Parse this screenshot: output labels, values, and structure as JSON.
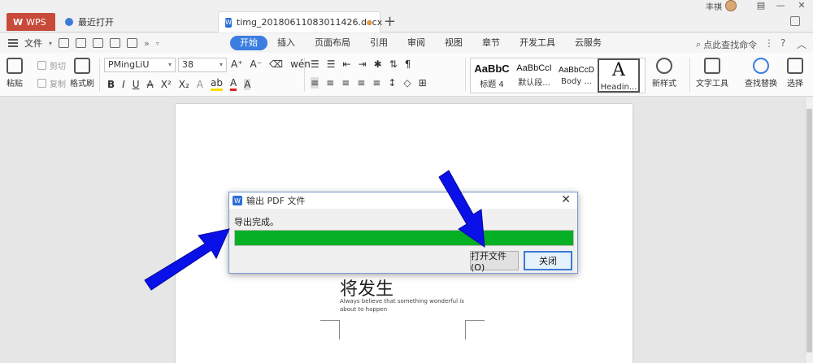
{
  "titlebar": {
    "wps_tab": "WPS",
    "recent_tab": "最近打开",
    "doc_tab": "timg_20180611083011426.docx",
    "add_tab": "+",
    "user_name": "丰祺"
  },
  "menubar": {
    "file_label": "文件",
    "ribbon_tabs": [
      "开始",
      "插入",
      "页面布局",
      "引用",
      "审阅",
      "视图",
      "章节",
      "开发工具",
      "云服务"
    ],
    "search_cmd": "点此查找命令"
  },
  "ribbon": {
    "paste": "粘贴",
    "cut": "剪切",
    "copy": "复制",
    "format_painter": "格式刷",
    "font_name": "PMingLiU",
    "font_size": "38",
    "styles": [
      {
        "preview": "AaBbC",
        "label": "标题 4"
      },
      {
        "preview": "AaBbCcI",
        "label": "默认段..."
      },
      {
        "preview": "AaBbCcD",
        "label": "Body ..."
      },
      {
        "preview": "A",
        "label": "Headin..."
      }
    ],
    "new_style": "新样式",
    "text_tools": "文字工具",
    "find_replace": "查找替换",
    "select": "选择"
  },
  "document": {
    "heading": "将发生",
    "subtext": "Always believe that something wonderful is about to happen"
  },
  "dialog": {
    "title": "输出 PDF 文件",
    "message": "导出完成。",
    "progress": 1.0,
    "open_button": "打开文件(O)",
    "close_button": "关闭",
    "progress_color": "#06b025"
  },
  "annotations": {
    "arrow_color": "#0a10e8"
  }
}
